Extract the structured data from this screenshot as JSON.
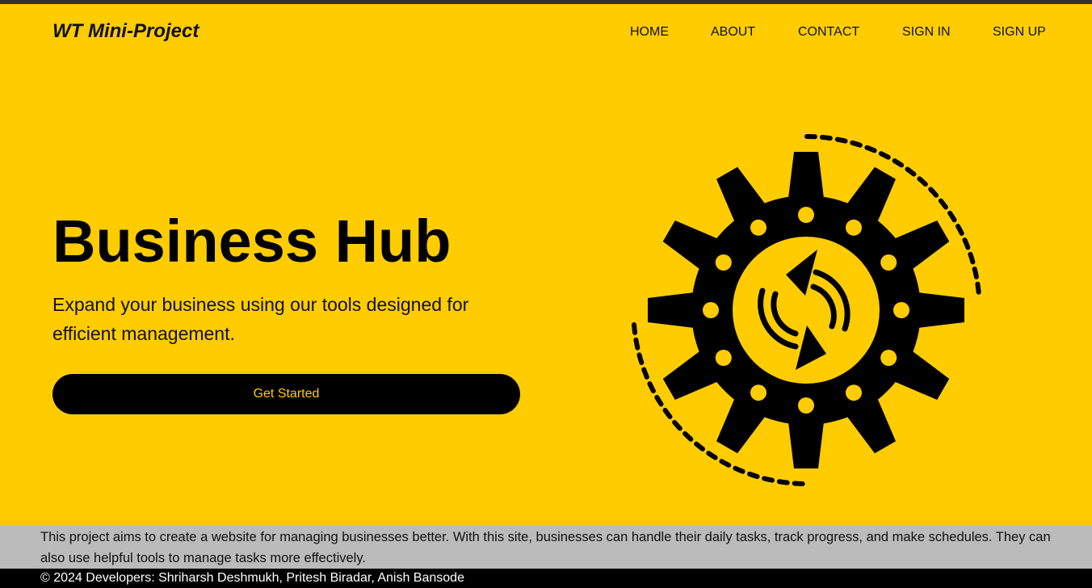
{
  "header": {
    "brand": "WT Mini-Project",
    "nav": [
      "HOME",
      "ABOUT",
      "CONTACT",
      "SIGN IN",
      "SIGN UP"
    ]
  },
  "hero": {
    "title": "Business Hub",
    "subtitle": "Expand your business using our tools designed for efficient management.",
    "cta_label": "Get Started",
    "illustration_icon": "gear-sync-icon"
  },
  "about": {
    "text": "This project aims to create a website for managing businesses better. With this site, businesses can handle their daily tasks, track progress, and make schedules. They can also use helpful tools to manage tasks more effectively."
  },
  "footer": {
    "text": "© 2024 Developers: Shriharsh Deshmukh, Pritesh Biradar, Anish Bansode"
  },
  "colors": {
    "accent": "#FFCC00",
    "dark": "#000000",
    "about_bg": "#BBBBBB",
    "top_strip": "#333333"
  }
}
